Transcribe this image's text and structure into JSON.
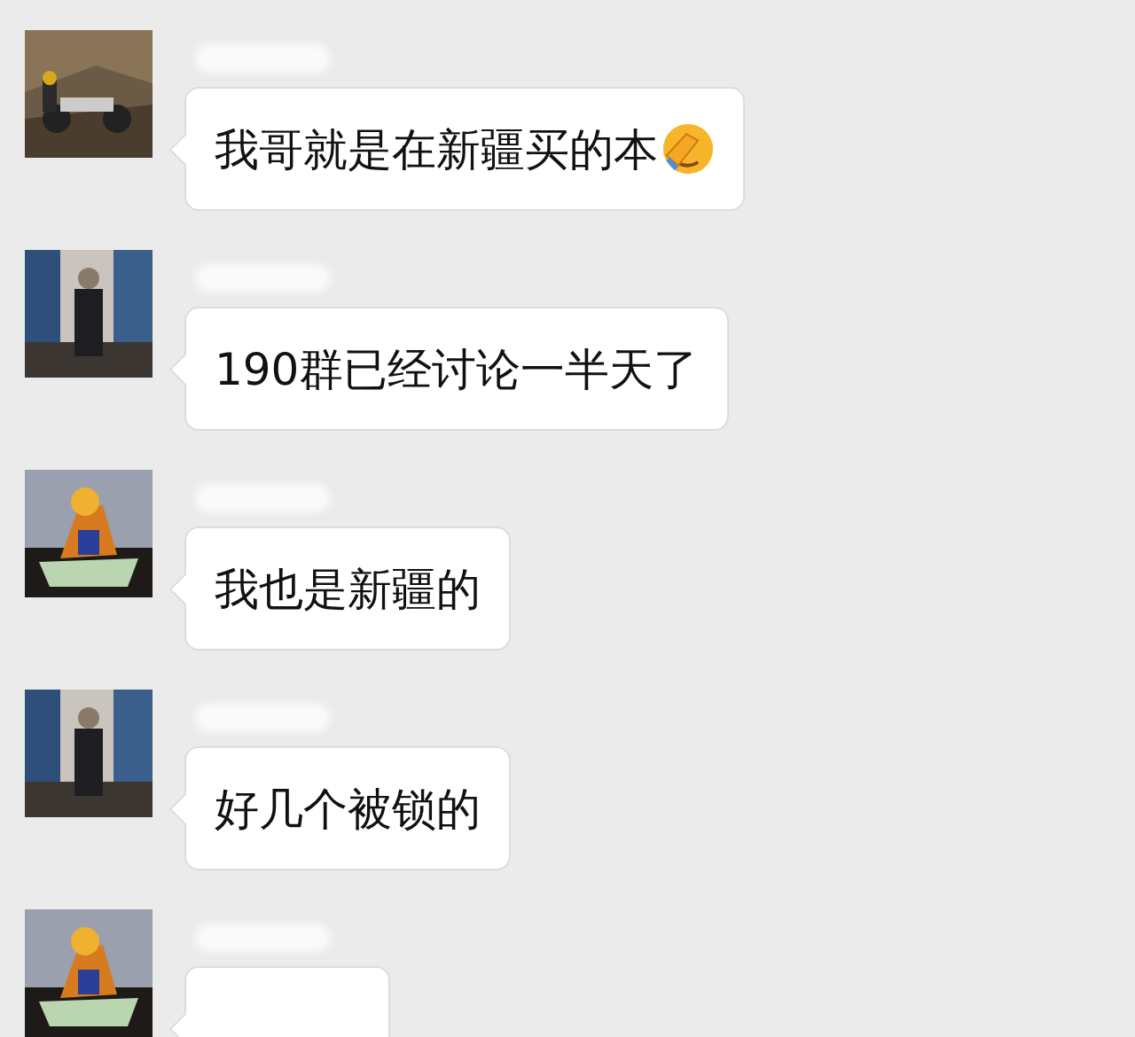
{
  "messages": [
    {
      "kind": "text_emoji",
      "text": "我哥就是在新疆买的本"
    },
    {
      "kind": "text",
      "text": "190群已经讨论一半天了"
    },
    {
      "kind": "text",
      "text": "我也是新疆的"
    },
    {
      "kind": "text",
      "text": "好几个被锁的"
    },
    {
      "kind": "blank"
    }
  ]
}
